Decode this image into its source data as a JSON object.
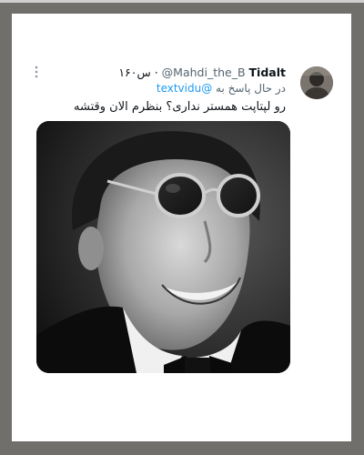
{
  "tweet": {
    "display_name": "Tidalt",
    "handle": "@Mahdi_the_B",
    "separator": " · ",
    "time": "۱۶۰س",
    "reply_prefix": "در حال پاسخ به",
    "reply_mention": "@textvidu",
    "text": "رو لپتاپت همستر نداری؟ بنظرم الان وقتشه",
    "more_icon": "more-vertical-icon",
    "image": "grayscale-portrait-photo"
  }
}
